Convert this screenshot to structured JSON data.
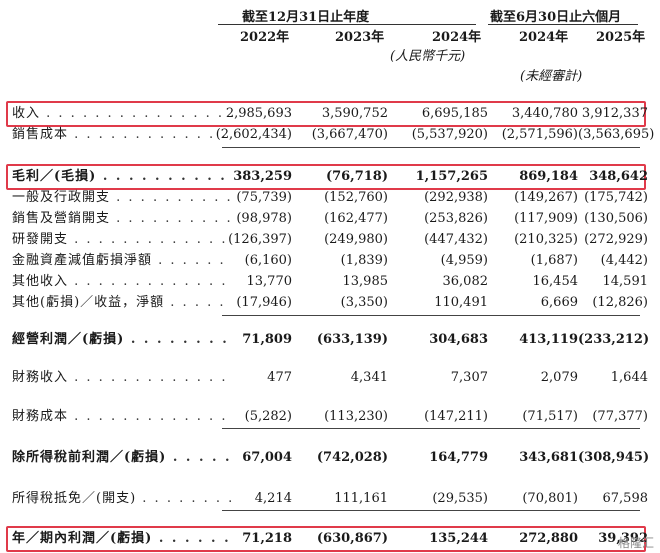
{
  "header": {
    "group_year": "截至12月31日止年度",
    "group_half": "截至6月30日止六個月",
    "years": [
      "2022年",
      "2023年",
      "2024年",
      "2024年",
      "2025年"
    ],
    "unit": "(人民幣千元)",
    "unaudited": "(未經審計)"
  },
  "rows": [
    {
      "label": "收入",
      "values": [
        "2,985,693",
        "3,590,752",
        "6,695,185",
        "3,440,780",
        "3,912,337"
      ]
    },
    {
      "label": "銷售成本",
      "values": [
        "(2,602,434)",
        "(3,667,470)",
        "(5,537,920)",
        "(2,571,596)",
        "(3,563,695)"
      ]
    },
    {
      "label": "毛利／(毛損)",
      "values": [
        "383,259",
        "(76,718)",
        "1,157,265",
        "869,184",
        "348,642"
      ]
    },
    {
      "label": "一般及行政開支",
      "values": [
        "(75,739)",
        "(152,760)",
        "(292,938)",
        "(149,267)",
        "(175,742)"
      ]
    },
    {
      "label": "銷售及營銷開支",
      "values": [
        "(98,978)",
        "(162,477)",
        "(253,826)",
        "(117,909)",
        "(130,506)"
      ]
    },
    {
      "label": "研發開支",
      "values": [
        "(126,397)",
        "(249,980)",
        "(447,432)",
        "(210,325)",
        "(272,929)"
      ]
    },
    {
      "label": "金融資產減值虧損淨額",
      "values": [
        "(6,160)",
        "(1,839)",
        "(4,959)",
        "(1,687)",
        "(4,442)"
      ]
    },
    {
      "label": "其他收入",
      "values": [
        "13,770",
        "13,985",
        "36,082",
        "16,454",
        "14,591"
      ]
    },
    {
      "label": "其他(虧損)／收益，淨額",
      "values": [
        "(17,946)",
        "(3,350)",
        "110,491",
        "6,669",
        "(12,826)"
      ]
    },
    {
      "label": "經營利潤／(虧損)",
      "values": [
        "71,809",
        "(633,139)",
        "304,683",
        "413,119",
        "(233,212)"
      ]
    },
    {
      "label": "財務收入",
      "values": [
        "477",
        "4,341",
        "7,307",
        "2,079",
        "1,644"
      ]
    },
    {
      "label": "財務成本",
      "values": [
        "(5,282)",
        "(113,230)",
        "(147,211)",
        "(71,517)",
        "(77,377)"
      ]
    },
    {
      "label": "除所得稅前利潤／(虧損)",
      "values": [
        "67,004",
        "(742,028)",
        "164,779",
        "343,681",
        "(308,945)"
      ]
    },
    {
      "label": "所得稅抵免／(開支)",
      "values": [
        "4,214",
        "111,161",
        "(29,535)",
        "(70,801)",
        "67,598"
      ]
    },
    {
      "label": "年／期內利潤／(虧損)",
      "values": [
        "71,218",
        "(630,867)",
        "135,244",
        "272,880",
        "39,392"
      ]
    }
  ],
  "watermark": "格隆汇",
  "highlight_color": "#e03a4a"
}
